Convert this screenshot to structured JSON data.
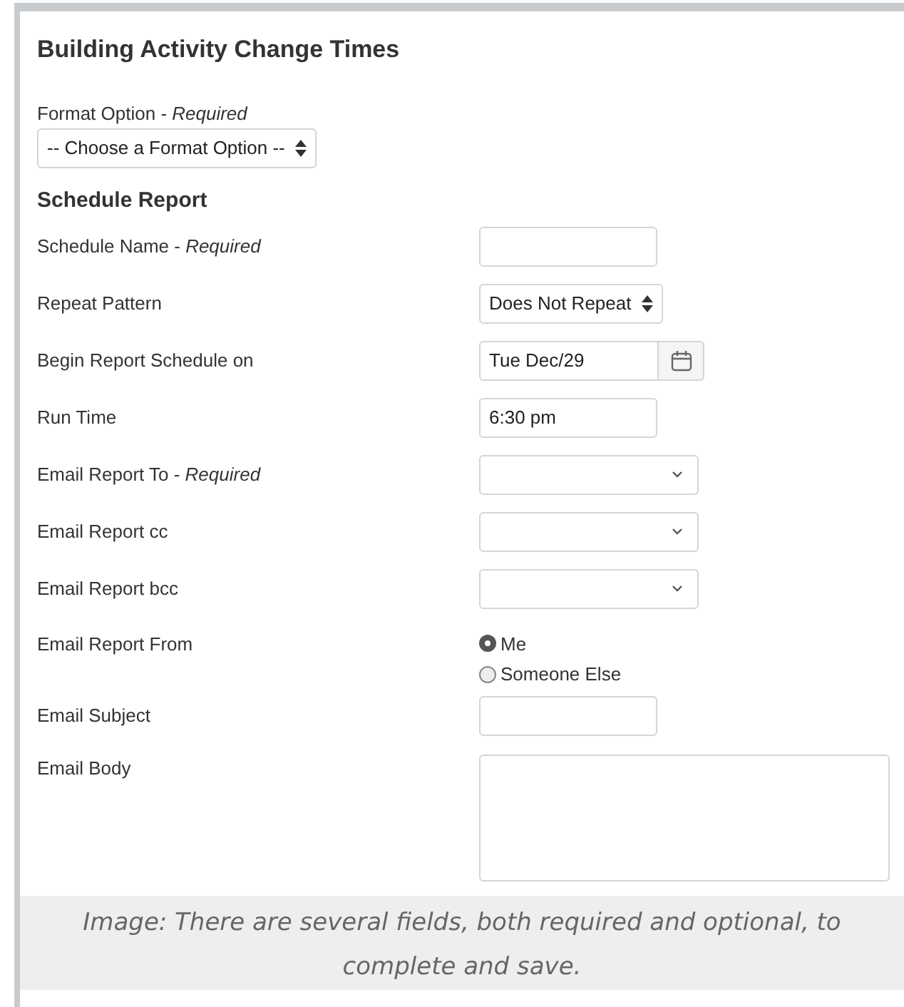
{
  "title": "Building Activity Change Times",
  "format": {
    "label": "Format Option - *Required*",
    "value": "-- Choose a Format Option --"
  },
  "section": "Schedule Report",
  "rows": [
    {
      "kind": "text",
      "label": "Schedule Name - *Required*"
    },
    {
      "kind": "select",
      "label": "Repeat Pattern",
      "value": "Does Not Repeat"
    },
    {
      "kind": "date",
      "label": "Begin Report Schedule on",
      "value": "Tue Dec/29"
    },
    {
      "kind": "text",
      "label": "Run Time",
      "value": "6:30 pm"
    },
    {
      "kind": "dropdown",
      "label": "Email Report To - *Required*"
    },
    {
      "kind": "dropdown",
      "label": "Email Report cc"
    },
    {
      "kind": "dropdown",
      "label": "Email Report bcc"
    },
    {
      "kind": "radio",
      "label": "Email Report From",
      "options": [
        {
          "label": "Me",
          "selected": true
        },
        {
          "label": "Someone Else",
          "selected": false
        }
      ]
    },
    {
      "kind": "text",
      "label": "Email Subject"
    },
    {
      "kind": "textarea",
      "label": "Email Body"
    }
  ],
  "caption": "Image: There are several fields, both required and optional, to complete and save."
}
